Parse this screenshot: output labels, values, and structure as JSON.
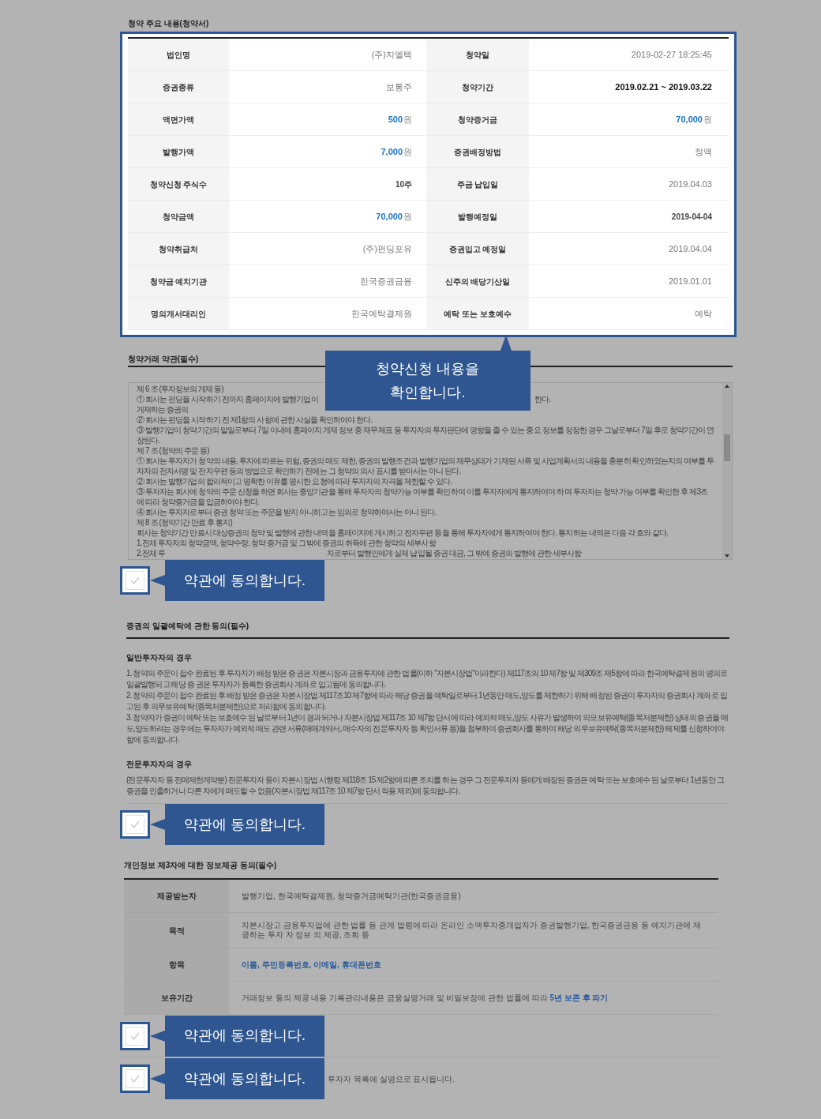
{
  "summary": {
    "title": "청약 주요 내용(청약서)",
    "rows": [
      {
        "cells": [
          {
            "label": "법인명",
            "value": "(주)지엘텍",
            "kind": "plain"
          },
          {
            "label": "청약일",
            "value": "2019-02-27 18:25:45",
            "kind": "plain"
          }
        ]
      },
      {
        "cells": [
          {
            "label": "증권종류",
            "value": "보통주",
            "kind": "plain"
          },
          {
            "label": "청약기간",
            "value": "2019.02.21 ~ 2019.03.22",
            "kind": "bold"
          }
        ]
      },
      {
        "cells": [
          {
            "label": "액면가액",
            "value": "500",
            "unit": "원",
            "kind": "amount"
          },
          {
            "label": "청약증거금",
            "value": "70,000",
            "unit": "원",
            "kind": "amount"
          }
        ]
      },
      {
        "cells": [
          {
            "label": "발행가액",
            "value": "7,000",
            "unit": "원",
            "kind": "amount"
          },
          {
            "label": "증권배정방법",
            "value": "정액",
            "kind": "plain"
          }
        ]
      },
      {
        "cells": [
          {
            "label": "청약신청 주식수",
            "value": "10주",
            "kind": "small"
          },
          {
            "label": "주금 납입일",
            "value": "2019.04.03",
            "kind": "plain"
          }
        ]
      },
      {
        "cells": [
          {
            "label": "청약금액",
            "value": "70,000",
            "unit": "원",
            "kind": "amount"
          },
          {
            "label": "발행예정일",
            "value": "2019-04-04",
            "kind": "small"
          }
        ]
      },
      {
        "cells": [
          {
            "label": "청약취급처",
            "value": "(주)펀딩포유",
            "kind": "plain"
          },
          {
            "label": "증권입고 예정일",
            "value": "2019.04.04",
            "kind": "plain"
          }
        ]
      },
      {
        "cells": [
          {
            "label": "청약금 예치기관",
            "value": "한국증권금융",
            "kind": "plain"
          },
          {
            "label": "신주의 배당기산일",
            "value": "2019.01.01",
            "kind": "plain"
          }
        ]
      },
      {
        "cells": [
          {
            "label": "명의개서대리인",
            "value": "한국예탁결제원",
            "kind": "plain"
          },
          {
            "label": "예탁 또는 보호예수",
            "value": "예탁",
            "kind": "plain"
          }
        ]
      }
    ],
    "callout": "청약신청 내용을 확인합니다."
  },
  "terms": {
    "title": "청약거래 약관(필수)",
    "lines": [
      {
        "kind": "line",
        "text": "제 6 조 (투자정보의 게재 등)"
      },
      {
        "kind": "covered",
        "before": "① 회사는 펀딩을 시작하기 전까지 홈페이지에 발행기업이 게재하는 증권의",
        "after": "한다."
      },
      {
        "kind": "line",
        "text": "② 회사는 펀딩을 시작하기 전 제1항의 사항에 관한 사실을 확인하여야 한다."
      },
      {
        "kind": "line",
        "text": "③ 발행기업이 청약기간의 말일로부터 7일 이내에 홈페이지 게재 정보 중 재무제표 등 투자자의 투자판단에 영향을 줄 수 있는 중요 정보를 정정한 경우 그날로부터 7일 후로 청약기간이 연장된다."
      },
      {
        "kind": "line",
        "text": "제 7 조 (청약의 주문 등)"
      },
      {
        "kind": "line",
        "text": "① 회사는 투자자가 청약의 내용, 투자에 따르는 위험, 증권의 매도 제한, 증권의 발행조건과 발행기업의 재무상태가 기재된 서류 및 사업계획서의 내용을 충분히 확인하였는지의 여부를 투자자의 전자서명 및 전자우편 등의 방법으로 확인하기 전에는 그 청약의 의사 표시를 받아서는 아니 된다."
      },
      {
        "kind": "line",
        "text": "② 회사는 발행기업의 합리적이고 명확한 이유를 명시한 요청에 따라 투자자의 자격을 제한할 수 있다."
      },
      {
        "kind": "line",
        "text": "③ 투자자는 회사에 청약의 주문 신청을 하면 회사는 중앙기관을 통해 투자자의 청약가능 여부를 확인하여 이를 투자자에게 통지하여야 하며 투자자는 청약 가능 여부를 확인한 후 제3조에 따라 청약증거금을 입금하여야 한다."
      },
      {
        "kind": "line",
        "text": "④ 회사는 투자자로부터 증권 청약 또는 주문을 받지 아니하고는 임의로 청약하여서는 아니 된다."
      },
      {
        "kind": "line",
        "text": "제 8 조 (청약기간 만료 후 통지)"
      },
      {
        "kind": "line",
        "text": "회사는 청약기간 만료시 대상증권의 청약 및 발행에 관한 내역을 홈페이지에 게시하고 전자우편 등을 통해 투자자에게 통지하여야 한다. 통지하는 내역은 다음 각 호와 같다."
      },
      {
        "kind": "line",
        "text": "1.전체 투자자의 청약금액, 청약수량, 청약 증거금 및 그밖에 증권의 취득에 관한 청약의 세부사항"
      },
      {
        "kind": "covered",
        "before": "2.전체 투",
        "after": "자로부터 발행인에게 실제 납입될 증권 대금, 그 밖에 증권의 발행에 관한 세부사항"
      }
    ],
    "agree": {
      "checked": false,
      "callout": "약관에 동의합니다."
    }
  },
  "deposit": {
    "title": "증권의 일괄예탁에 관한 동의(필수)",
    "groups": [
      {
        "heading": "일반투자자의 경우",
        "paragraphs": [
          "1. 청약의 주문이 접수 완료된 후 투자자가 배정 받은 증권은 자본시장과 금융투자에 관한 법률(이하 \"자본시장법\"이라한다) 제117조의 10 제7항 및 제309조 제5항에 따라 한국예탁결제원의 명의로 일괄발행되고 해당 증 권은 투자자가 등록한 증권회사 계좌로 입고됨에 동의합니다.",
          "2. 청약의 주문이 접수 완료된 후 배정 받은 증권은 자본시장법 제117조10 제7항에 따라 해당 증권을 예탁일로부터 1년동안 매도,양도를 제한하기 위해 배정된 증권이 투자자의 증권회사 계좌로 입고된 후 의무보유예탁 (종목처분제한)으로 처리함에 동의합니다.",
          "3. 청약자가 증권이 예탁 또는 보호예수 된 날로부터 1년이 경과되거나 자본시장법 제117조 10 제7항 단서에 따라 예외적 매도,양도 사유가 발생하여 의모보유예탁(종목처분제한) 상태의 증권을 매도,양도하려는 경우에는 투자자가 예외적 매도 관련 서류(매매계약서, 매수자의 전문투자자 등 확인서류 등)을 첨부하여 증권회사를 통하여 해당 의무보유예탁(종목처분제한) 해제를 신청하여야 함에 동의합니다."
        ]
      },
      {
        "heading": "전문투자자의 경우",
        "paragraphs": [
          "(전문투자자 등 전매제한계약분) 전문투자자 등이 자본시장법 시행령 제118조 15 제2항에 따른 조치를 하는 경우 그 전문투자자 등에게 배정된 증권은 예탁 또는 보호예수 된 날로부터 1년동안 그 증권을 인출하거나 다른 자에게 매도할 수 없음(자본시장법 제117조 10 제7항 단서 적용 제외)에 동의합니다."
        ]
      }
    ],
    "agree": {
      "checked": false,
      "callout": "약관에 동의합니다."
    }
  },
  "privacy": {
    "title": "개인정보 제3자에 대한 정보제공 동의(필수)",
    "rows": [
      {
        "kind": "info",
        "label": "제공받는자",
        "segments": [
          {
            "text": "발행기업, 한국예탁결제원, 청약증거금예탁기관(한국증권금융)",
            "emphasis": false
          }
        ]
      },
      {
        "kind": "info",
        "label": "목적",
        "segments": [
          {
            "text": "자본시장고 금융투자업에 관한 법률 등 관계 법령에 따라 온라인 소액투자중개업자가 증권발행기업, 한국증권금융 등 예치기관에 제공하는 투자 자 정보 의 제공, 조회 등",
            "emphasis": false
          }
        ]
      },
      {
        "kind": "info",
        "label": "항목",
        "segments": [
          {
            "text": "이름, 주민등록번호, 이메일, 휴대폰번호",
            "emphasis": true
          }
        ]
      },
      {
        "kind": "info",
        "label": "보유기간",
        "segments": [
          {
            "text": "거래정보 등의 제공 내용 기록관리내용은 금융실명거래 및 비밀보장에 관한 법률에 따라 ",
            "emphasis": false
          },
          {
            "text": "5년 보존 후 파기",
            "emphasis": true
          }
        ]
      },
      {
        "kind": "agree",
        "checked": false,
        "callout": "약관에 동의합니다."
      },
      {
        "kind": "agree",
        "checked": false,
        "callout": "약관에 동의합니다.",
        "after": "투자자 목록에 실명으로 표시됩니다."
      }
    ]
  }
}
